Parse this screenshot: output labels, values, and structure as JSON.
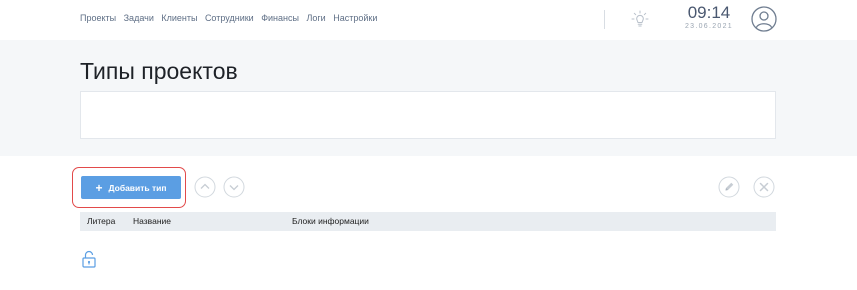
{
  "nav": {
    "items": [
      "Проекты",
      "Задачи",
      "Клиенты",
      "Сотрудники",
      "Финансы",
      "Логи",
      "Настройки"
    ]
  },
  "clock": {
    "time": "09:14",
    "date": "23.06.2021"
  },
  "page": {
    "title": "Типы проектов"
  },
  "toolbar": {
    "add_label": "Добавить тип",
    "add_icon": "plus-icon"
  },
  "table": {
    "columns": [
      "Литера",
      "Название",
      "Блоки информации"
    ],
    "rows": []
  },
  "icons": {
    "theme": "lightbulb-icon",
    "user": "user-avatar-icon",
    "move_up": "chevron-up-icon",
    "move_down": "chevron-down-icon",
    "edit": "pencil-icon",
    "delete": "close-icon",
    "lock": "unlock-icon"
  },
  "colors": {
    "accent": "#5b9ee3",
    "highlight": "#e24a4a",
    "nav_text": "#5f6f86",
    "icon_gray": "#c7cdd4"
  }
}
